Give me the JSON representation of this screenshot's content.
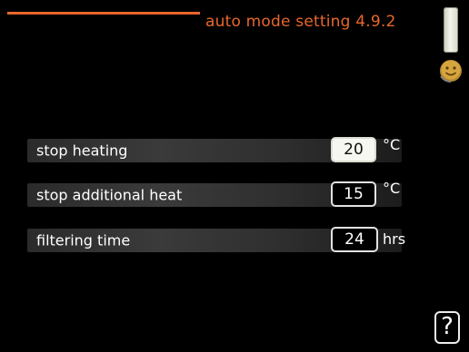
{
  "header": {
    "title": "auto mode setting 4.9.2",
    "accent_color": "#e8672a"
  },
  "side_icons": {
    "scroll_indicator": "scroll-bar",
    "status_icon": "smiley-face-icon"
  },
  "settings": [
    {
      "label": "stop heating",
      "value": "20",
      "unit": "°C",
      "selected": true
    },
    {
      "label": "stop additional heat",
      "value": "15",
      "unit": "°C",
      "selected": false
    },
    {
      "label": "filtering time",
      "value": "24",
      "unit": "hrs",
      "selected": false
    }
  ],
  "help": {
    "label": "?"
  }
}
